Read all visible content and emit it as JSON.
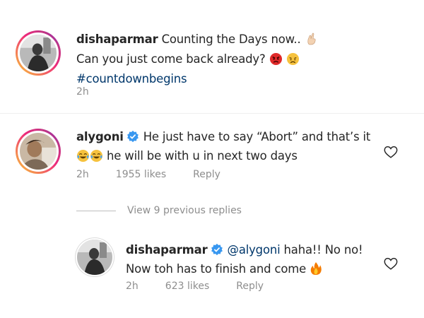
{
  "caption": {
    "username": "dishaparmar",
    "line1": "Counting the Days now..",
    "line2": "Can you just come back already?",
    "hashtag": "#countdownbegins",
    "time": "2h"
  },
  "comment": {
    "username": "alygoni",
    "line1": "He just have to say “Abort” and that’s it",
    "line2": "he will be with u in next two days",
    "time": "2h",
    "likes": "1955 likes",
    "reply_label": "Reply"
  },
  "view_replies": "View 9 previous replies",
  "reply": {
    "username": "dishaparmar",
    "mention": "@alygoni",
    "line1": "haha!! No no!",
    "line2": "Now toh has to finish and come",
    "time": "2h",
    "likes": "623 likes",
    "reply_label": "Reply"
  },
  "colors": {
    "link": "#00376b",
    "secondary_text": "#8e8e8e",
    "verified": "#3897f0"
  },
  "icons": {
    "verified": "verified-badge-icon",
    "heart": "heart-outline-icon",
    "fingers": "crossed-fingers-emoji",
    "angry": "angry-face-emoji",
    "sad": "disappointed-face-emoji",
    "laugh": "tears-of-joy-emoji",
    "fire": "fire-emoji"
  }
}
